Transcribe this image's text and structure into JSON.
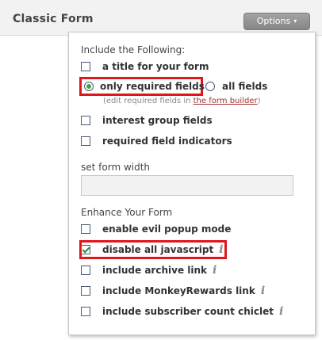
{
  "header": {
    "title": "Classic Form",
    "options_label": "Options",
    "options_caret": "▾"
  },
  "panel": {
    "include_heading": "Include the Following:",
    "include_items": [
      {
        "label": "a title for your form",
        "control": "checkbox",
        "checked": false
      },
      {
        "label": "only required fields",
        "control": "radio",
        "checked": true
      },
      {
        "label": "all fields",
        "control": "radio",
        "checked": false
      },
      {
        "label": "interest group fields",
        "control": "checkbox",
        "checked": false
      },
      {
        "label": "required field indicators",
        "control": "checkbox",
        "checked": false
      }
    ],
    "required_hint_prefix": "(edit required fields in ",
    "required_hint_link": "the form builder",
    "required_hint_suffix": ")",
    "width_heading": "set form width",
    "width_value": "",
    "enhance_heading": "Enhance Your Form",
    "enhance_items": [
      {
        "label": "enable evil popup mode",
        "checked": false,
        "info": false
      },
      {
        "label": "disable all javascript",
        "checked": true,
        "info": true
      },
      {
        "label": "include archive link",
        "checked": false,
        "info": true
      },
      {
        "label": "include MonkeyRewards link",
        "checked": false,
        "info": true
      },
      {
        "label": "include subscriber count chiclet",
        "checked": false,
        "info": true
      }
    ],
    "info_glyph": "i"
  },
  "colors": {
    "highlight": "#e0161b",
    "radio_selected": "#3aa63a",
    "checkmark": "#2b8a2b",
    "link": "#a03030"
  }
}
